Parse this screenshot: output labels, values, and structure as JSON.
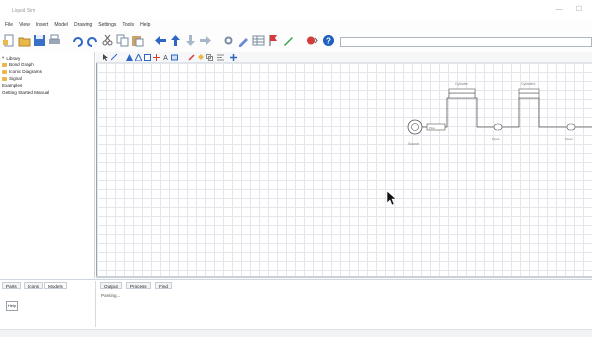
{
  "app": {
    "title": "Liquid Sim"
  },
  "window_controls": {
    "minimize": "—",
    "maximize": "☐"
  },
  "menu": [
    "File",
    "View",
    "Insert",
    "Model",
    "Drawing",
    "Settings",
    "Tools",
    "Help"
  ],
  "toolbar": {
    "icons": [
      "new-icon",
      "open-icon",
      "save-icon",
      "print-icon",
      "undo-icon",
      "redo-icon",
      "cut-icon",
      "copy-icon",
      "paste-icon",
      "back-icon",
      "up-icon",
      "down-icon",
      "forward-icon",
      "settings-icon",
      "edit-icon",
      "table-icon",
      "flag-icon",
      "pencil-icon",
      "record-icon",
      "help-icon"
    ],
    "address_value": ""
  },
  "library": {
    "items": [
      {
        "label": "Library",
        "folder": false
      },
      {
        "label": "Bond Graph",
        "folder": true
      },
      {
        "label": "Iconic Diagrams",
        "folder": true
      },
      {
        "label": "Signal",
        "folder": true
      },
      {
        "label": "Examples",
        "folder": false
      },
      {
        "label": "Getting Started Manual",
        "folder": false
      }
    ]
  },
  "drawing_toolbar": {
    "icons": [
      "pointer-icon",
      "line-icon",
      "triangle-icon",
      "triangle-outline-icon",
      "rect-icon",
      "grid-icon",
      "text-icon",
      "image-icon",
      "pen-icon",
      "fill-icon",
      "group-icon",
      "align-icon",
      "zoom-icon"
    ]
  },
  "diagram": {
    "labels": [
      "Source",
      "Cylinder",
      "Cylinder1",
      "Pipe",
      "Pipe1",
      "Pipe2"
    ]
  },
  "bottom": {
    "left_tabs": [
      "Parts",
      "Icons",
      "Models"
    ],
    "right_tabs": [
      "Output",
      "Process",
      "Find"
    ],
    "output_text": "Parsing...",
    "button_label": "Help"
  },
  "colors": {
    "accent": "#1f5fbf",
    "folder": "#e8b84a",
    "grid": "#e3e7ec"
  }
}
